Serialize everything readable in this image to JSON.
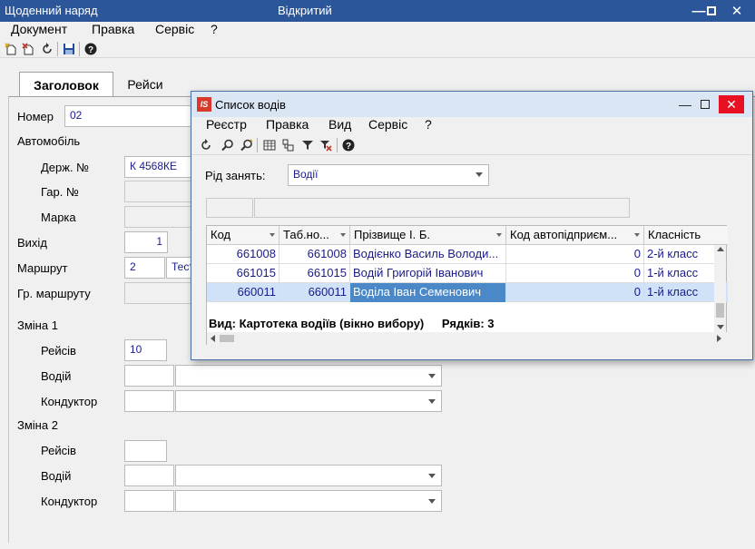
{
  "main_window": {
    "title": "Щоденний наряд",
    "status": "Відкритий",
    "controls": {
      "minimize": "—",
      "maximize": "☐",
      "close": "✕"
    },
    "menu": [
      "Документ",
      "Правка",
      "Сервіс",
      "?"
    ],
    "tabs": [
      "Заголовок",
      "Рейси"
    ],
    "form": {
      "nomer_label": "Номер",
      "nomer_value": "02",
      "avto_label": "Автомобіль",
      "derzh_label": "Держ. №",
      "derzh_value": "К 4568КЕ",
      "gar_label": "Гар. №",
      "marka_label": "Марка",
      "vyhid_label": "Вихід",
      "vyhid_value": "1",
      "marshrut_label": "Маршрут",
      "marshrut_value": "2",
      "marshrut_name": "Тест",
      "gr_marshrutu_label": "Гр. маршруту",
      "zmina1_label": "Зміна 1",
      "reysiv1_label": "Рейсів",
      "reysiv1_value": "10",
      "vodiy1_label": "Водій",
      "konduktor1_label": "Кондуктор",
      "zmina2_label": "Зміна 2",
      "reysiv2_label": "Рейсів",
      "vodiy2_label": "Водій",
      "konduktor2_label": "Кондуктор"
    }
  },
  "dialog": {
    "title": "Список водів",
    "icon_text": "IS",
    "controls": {
      "minimize": "—",
      "maximize": "☐",
      "close": "✕"
    },
    "menu": [
      "Реєстр",
      "Правка",
      "Вид",
      "Сервіс",
      "?"
    ],
    "rid_label": "Рід занять:",
    "rid_value": "Водії",
    "columns": [
      "Код",
      "Таб.но...",
      "Прізвище І. Б.",
      "Код автопідприєм...",
      "Класність"
    ],
    "rows": [
      {
        "kod": "661008",
        "tab": "661008",
        "name": "Водієнко Василь Володи...",
        "kod_avto": "0",
        "klas": "2-й класс"
      },
      {
        "kod": "661015",
        "tab": "661015",
        "name": "Водій Григорій Іванович",
        "kod_avto": "0",
        "klas": "1-й класс"
      },
      {
        "kod": "660011",
        "tab": "660011",
        "name": "Воділа Іван Семенович",
        "kod_avto": "0",
        "klas": "1-й класс"
      }
    ],
    "status_view": "Вид: Картотека водіїв (вікно вибору)",
    "status_rows": "Рядків: 3"
  }
}
